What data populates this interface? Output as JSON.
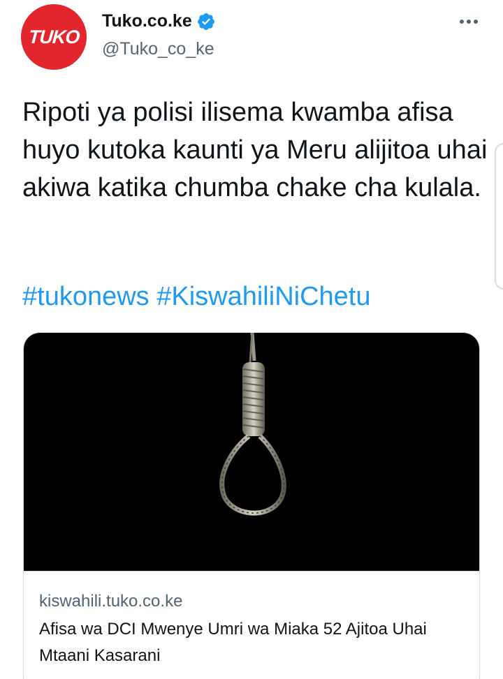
{
  "author": {
    "avatar_text": "TUKO",
    "display_name": "Tuko.co.ke",
    "handle": "@Tuko_co_ke",
    "verified": true
  },
  "tweet": {
    "text": "Ripoti ya polisi ilisema kwamba afisa huyo kutoka kaunti ya Meru alijitoa uhai akiwa katika chumba chake cha kulala.",
    "hashtags": [
      "#tukonews",
      "#KiswahiliNiChetu"
    ]
  },
  "card": {
    "domain": "kiswahili.tuko.co.ke",
    "title": "Afisa wa DCI Mwenye Umri wa Miaka 52 Ajitoa Uhai Mtaani Kasarani"
  },
  "icons": {
    "verified": "verified-badge-icon",
    "more": "more-options-icon"
  },
  "colors": {
    "brand_red": "#e3262d",
    "link_blue": "#1d9bf0",
    "verified_blue": "#1d9bf0",
    "secondary_text": "#536471"
  }
}
